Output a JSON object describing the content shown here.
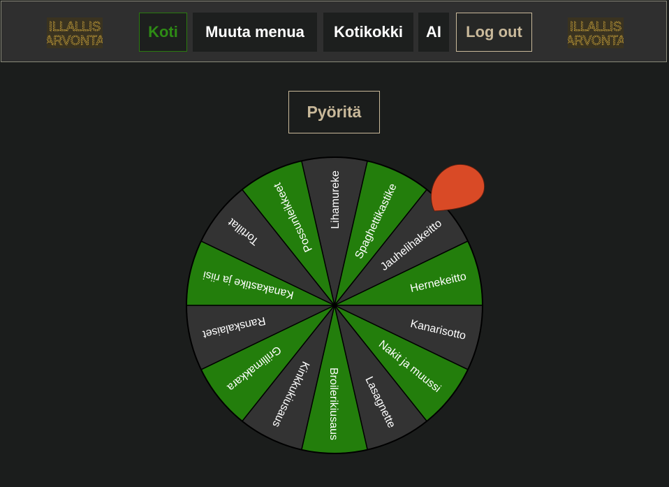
{
  "nav": {
    "logo_text": [
      "ILLALLIS",
      "ARVONTA"
    ],
    "items": [
      {
        "label": "Koti"
      },
      {
        "label": "Muuta menua"
      },
      {
        "label": "Kotikokki"
      },
      {
        "label": "AI"
      },
      {
        "label": "Log out"
      }
    ]
  },
  "spin_button": {
    "label": "Pyöritä"
  },
  "wheel": {
    "segments": [
      {
        "label": "Lihamureke",
        "color": "#333333"
      },
      {
        "label": "Spaghettikastike",
        "color": "#237e0c"
      },
      {
        "label": "Jauhelihakeitto",
        "color": "#333333"
      },
      {
        "label": "Hernekeitto",
        "color": "#237e0c"
      },
      {
        "label": "Kanarisotto",
        "color": "#333333"
      },
      {
        "label": "Nakit ja muussi",
        "color": "#237e0c"
      },
      {
        "label": "Lasagnette",
        "color": "#333333"
      },
      {
        "label": "Broilerikiusaus",
        "color": "#237e0c"
      },
      {
        "label": "Kinkkukiusaus",
        "color": "#333333"
      },
      {
        "label": "Grillimakkara",
        "color": "#237e0c"
      },
      {
        "label": "Ranskalaiset",
        "color": "#333333"
      },
      {
        "label": "Kanakastike ja riisi",
        "color": "#237e0c"
      },
      {
        "label": "Tortillat",
        "color": "#333333"
      },
      {
        "label": "Possunleikkeet",
        "color": "#237e0c"
      }
    ],
    "pointer_color": "#d94a26",
    "text_color": "#ffffff"
  },
  "colors": {
    "active_nav": "#2e8b15",
    "logout_accent": "#c9b99a",
    "logo_gold": "#c9a23a"
  }
}
